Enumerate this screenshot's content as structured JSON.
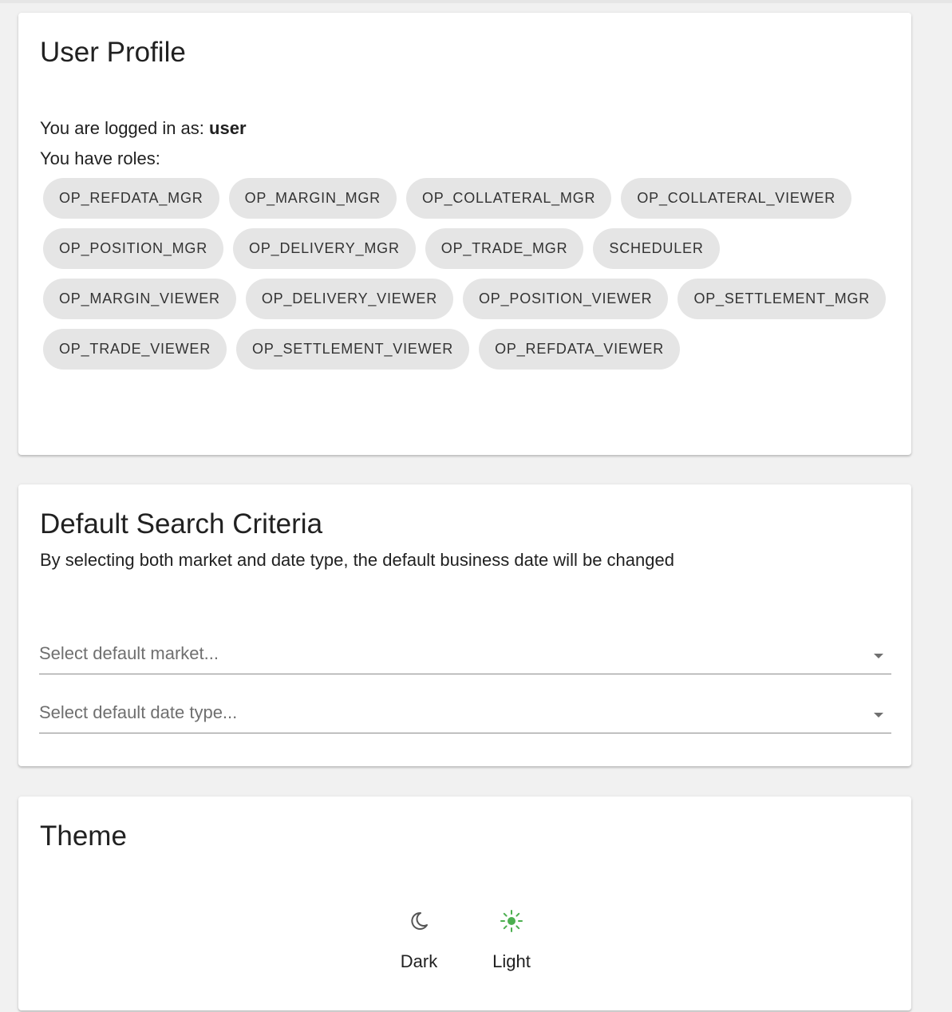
{
  "profile": {
    "title": "User Profile",
    "logged_in_prefix": "You are logged in as: ",
    "username": "user",
    "roles_label": "You have roles:",
    "roles": [
      "OP_REFDATA_MGR",
      "OP_MARGIN_MGR",
      "OP_COLLATERAL_MGR",
      "OP_COLLATERAL_VIEWER",
      "OP_POSITION_MGR",
      "OP_DELIVERY_MGR",
      "OP_TRADE_MGR",
      "SCHEDULER",
      "OP_MARGIN_VIEWER",
      "OP_DELIVERY_VIEWER",
      "OP_POSITION_VIEWER",
      "OP_SETTLEMENT_MGR",
      "OP_TRADE_VIEWER",
      "OP_SETTLEMENT_VIEWER",
      "OP_REFDATA_VIEWER"
    ]
  },
  "search_criteria": {
    "title": "Default Search Criteria",
    "subtitle": "By selecting both market and date type, the default business date will be changed",
    "market_placeholder": "Select default market...",
    "date_type_placeholder": "Select default date type..."
  },
  "theme": {
    "title": "Theme",
    "dark_label": "Dark",
    "light_label": "Light",
    "dark_icon": "moon-icon",
    "light_icon": "sun-icon",
    "selected": "Light",
    "accent_color": "#4caf50"
  }
}
